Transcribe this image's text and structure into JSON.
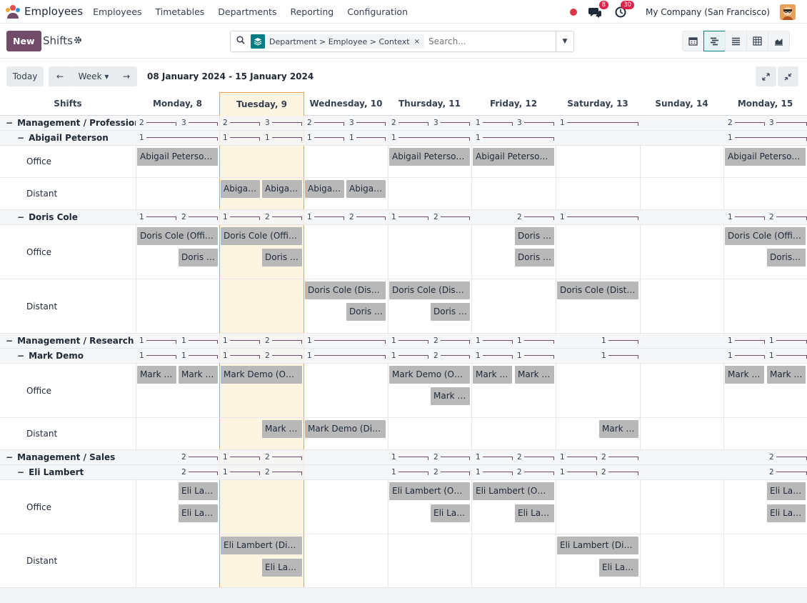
{
  "navbar": {
    "app_name": "Employees",
    "menu": [
      "Employees",
      "Timetables",
      "Departments",
      "Reporting",
      "Configuration"
    ],
    "messages_count": "8",
    "activities_count": "30",
    "company": "My Company (San Francisco)"
  },
  "control": {
    "new_label": "New",
    "title": "Shifts",
    "facet_label": "Department > Employee > Context",
    "facet_remove": "×",
    "search_placeholder": "Search..."
  },
  "toolbar": {
    "today_label": "Today",
    "prev_label": "←",
    "scale_label": "Week ▾",
    "next_label": "→",
    "date_range": "08 January 2024 - 15 January 2024"
  },
  "gantt": {
    "rows_header": "Shifts",
    "days": [
      "Monday, 8",
      "Tuesday, 9",
      "Wednesday, 10",
      "Thursday, 11",
      "Friday, 12",
      "Saturday, 13",
      "Sunday, 14",
      "Monday, 15"
    ],
    "row_labels": {
      "g1": "Management / Profession...",
      "e1": "Abigail Peterson",
      "e2": "Doris Cole",
      "g2": "Management / Research &...",
      "e3": "Mark Demo",
      "g3": "Management / Sales",
      "e4": "Eli Lambert",
      "office": "Office",
      "distant": "Distant"
    },
    "pills": {
      "abigail_office": "Abigail Peterson (Office)",
      "abigail_distant": "Abigail Peterson (Distant)",
      "doris_office": "Doris Cole (Office)",
      "doris_distant": "Doris Cole (Distant)",
      "mark_office": "Mark Demo (Office)",
      "mark_distant": "Mark Demo (Distant)",
      "eli_office": "Eli Lambert (Office)",
      "eli_distant": "Eli Lambert (Distant)"
    },
    "counts": {
      "n1": "1",
      "n2": "2",
      "n3": "3"
    }
  }
}
